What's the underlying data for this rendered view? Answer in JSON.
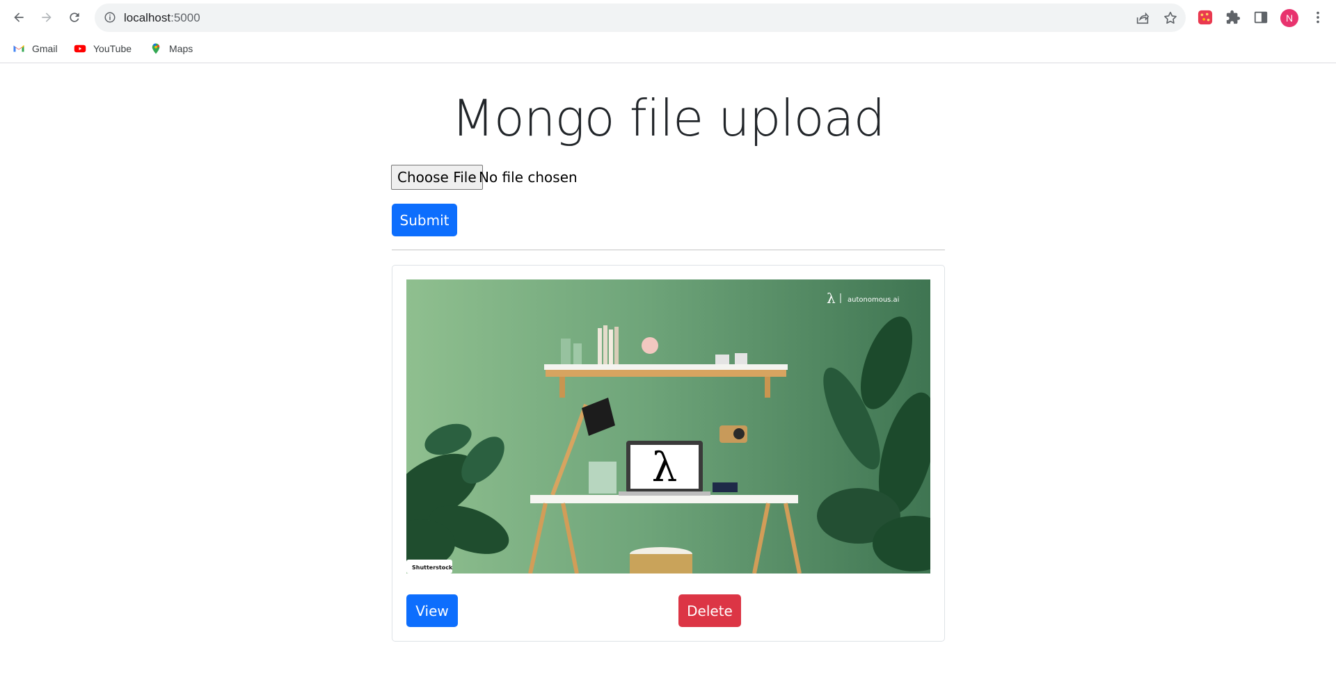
{
  "browser": {
    "url_host": "localhost",
    "url_port": ":5000",
    "profile_initial": "N",
    "bookmarks": [
      {
        "label": "Gmail",
        "icon": "gmail-icon"
      },
      {
        "label": "YouTube",
        "icon": "youtube-icon"
      },
      {
        "label": "Maps",
        "icon": "maps-icon"
      }
    ]
  },
  "page": {
    "title": "Mongo file upload",
    "choose_file_label": "Choose File",
    "file_status": "No file chosen",
    "submit_label": "Submit"
  },
  "card": {
    "image": {
      "brand_text": "autonomous.ai",
      "brand_symbol": "λ",
      "laptop_symbol": "λ",
      "watermark": "Shutterstock"
    },
    "view_label": "View",
    "delete_label": "Delete"
  },
  "colors": {
    "primary": "#0d6efd",
    "danger": "#dc3545",
    "wall_green": "#5e9870",
    "avatar": "#e8336e"
  }
}
